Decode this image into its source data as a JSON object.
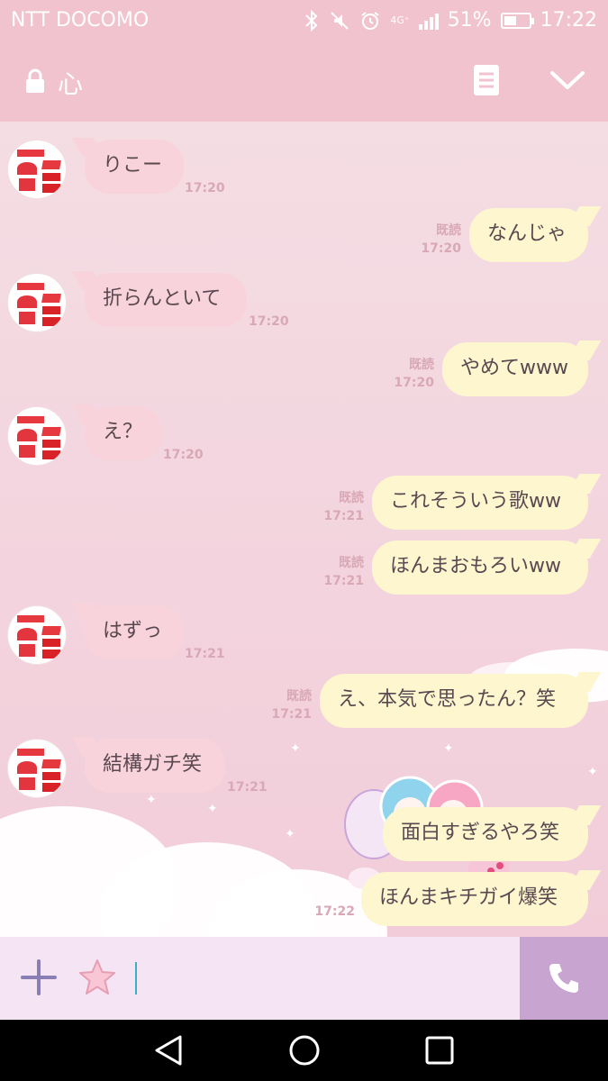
{
  "status_bar": {
    "carrier": "NTT DOCOMO",
    "network": "4G⁺",
    "battery_pct": "51%",
    "battery_level": 0.51,
    "time": "17:22"
  },
  "header": {
    "title": "心"
  },
  "messages": [
    {
      "side": "in",
      "text": "りこー",
      "time": "17:20"
    },
    {
      "side": "out",
      "text": "なんじゃ",
      "read": "既読",
      "time": "17:20"
    },
    {
      "side": "in",
      "text": "折らんといて",
      "time": "17:20"
    },
    {
      "side": "out",
      "text": "やめてwww",
      "read": "既読",
      "time": "17:20"
    },
    {
      "side": "in",
      "text": "え？",
      "time": "17:20"
    },
    {
      "side": "out",
      "text": "これそういう歌ww",
      "read": "既読",
      "time": "17:21"
    },
    {
      "side": "out",
      "text": "ほんまおもろいww",
      "read": "既読",
      "time": "17:21"
    },
    {
      "side": "in",
      "text": "はずっ",
      "time": "17:21"
    },
    {
      "side": "out",
      "text": "え、本気で思ったん？笑",
      "read": "既読",
      "time": "17:21"
    },
    {
      "side": "in",
      "text": "結構ガチ笑",
      "time": "17:21"
    },
    {
      "side": "out",
      "text": "面白すぎるやろ笑",
      "read": "",
      "time": ""
    },
    {
      "side": "out",
      "text": "ほんまキチガイ爆笑",
      "read": "",
      "time": "17:22"
    }
  ],
  "colors": {
    "header_bg": "#f1c3cf",
    "incoming_bubble": "#f9d3dc",
    "outgoing_bubble": "#fdf6cf",
    "meta_text": "#d9a8b6",
    "call_button": "#c8a4d0"
  },
  "icons": {
    "lock": "lock-icon",
    "notes": "note-icon",
    "collapse": "chevron-down-icon",
    "add": "plus-icon",
    "sticker": "star-icon",
    "call": "phone-icon",
    "back": "back-triangle-icon",
    "home": "home-circle-icon",
    "recents": "recents-square-icon"
  }
}
